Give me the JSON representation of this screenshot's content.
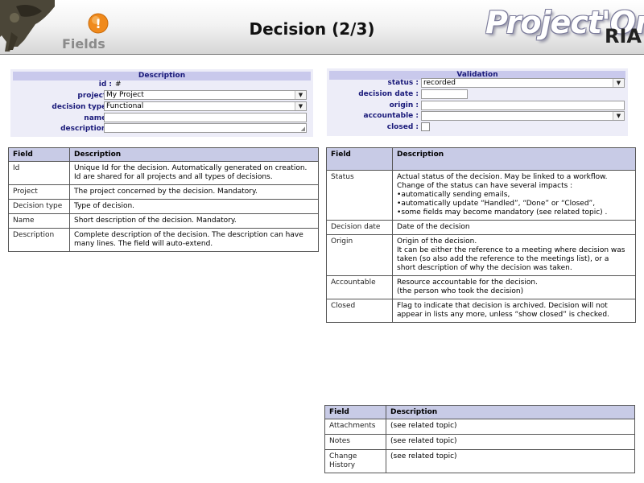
{
  "header": {
    "fields_label": "Fields",
    "title": "Decision (2/3)",
    "brand_main": "Project'Or",
    "brand_sub": "RIA",
    "warning_glyph": "!"
  },
  "description_form": {
    "title": "Description",
    "fields": {
      "id": {
        "label": "id :",
        "value": "#"
      },
      "project": {
        "label": "project :",
        "value": "My Project",
        "arrow": "▼"
      },
      "decision_type": {
        "label": "decision type :",
        "value": "Functional",
        "arrow": "▼"
      },
      "name": {
        "label": "name :",
        "value": ""
      },
      "description": {
        "label": "description :",
        "value": "",
        "grip": "◢"
      }
    }
  },
  "validation_form": {
    "title": "Validation",
    "fields": {
      "status": {
        "label": "status :",
        "value": "recorded",
        "arrow": "▼"
      },
      "decision_date": {
        "label": "decision date :",
        "value": ""
      },
      "origin": {
        "label": "origin :",
        "value": ""
      },
      "accountable": {
        "label": "accountable :",
        "value": "",
        "arrow": "▼"
      },
      "closed": {
        "label": "closed :",
        "checked": false
      }
    }
  },
  "table_left": {
    "headers": [
      "Field",
      "Description"
    ],
    "rows": [
      {
        "field": "Id",
        "lines": [
          "Unique Id for the decision. Automatically generated on creation.",
          "Id are shared for all projects and all types of decisions."
        ]
      },
      {
        "field": "Project",
        "lines": [
          "The project concerned by the decision. Mandatory."
        ]
      },
      {
        "field": "Decision type",
        "lines": [
          "Type of decision."
        ]
      },
      {
        "field": "Name",
        "lines": [
          "Short description of the decision. Mandatory."
        ]
      },
      {
        "field": "Description",
        "lines": [
          "Complete description of the decision. The description can have",
          "many lines. The field will auto-extend."
        ]
      }
    ]
  },
  "table_right": {
    "headers": [
      "Field",
      "Description"
    ],
    "status": {
      "field": "Status",
      "lines": [
        "Actual status of the decision. May be linked to a workflow.",
        "Change of the status can have several impacts :"
      ],
      "bullets": [
        "automatically sending emails,",
        "automatically update “Handled”, “Done” or “Closed”,",
        "some fields may become mandatory (see related topic) ."
      ]
    },
    "rows": [
      {
        "field": "Decision date",
        "lines": [
          "Date of the decision"
        ]
      },
      {
        "field": "Origin",
        "lines": [
          "Origin of the decision.",
          "It can be either the reference to a meeting where decision was",
          "taken (so also add the reference to the meetings list), or a",
          "short description of why the decision was taken."
        ]
      },
      {
        "field": "Accountable",
        "lines": [
          "Resource accountable for the decision.",
          "(the person who took the decision)"
        ]
      },
      {
        "field": "Closed",
        "lines": [
          "Flag to indicate that decision is archived. Decision will not",
          "appear in lists any more, unless “show closed” is checked."
        ]
      }
    ]
  },
  "table_bottom": {
    "headers": [
      "Field",
      "Description"
    ],
    "rows": [
      {
        "field": "Attachments",
        "lines": [
          "(see related topic)"
        ]
      },
      {
        "field": "Notes",
        "lines": [
          "(see related topic)"
        ]
      },
      {
        "field": "Change History",
        "field_lines": [
          "Change",
          "History"
        ],
        "lines": [
          "(see related topic)"
        ]
      }
    ]
  }
}
